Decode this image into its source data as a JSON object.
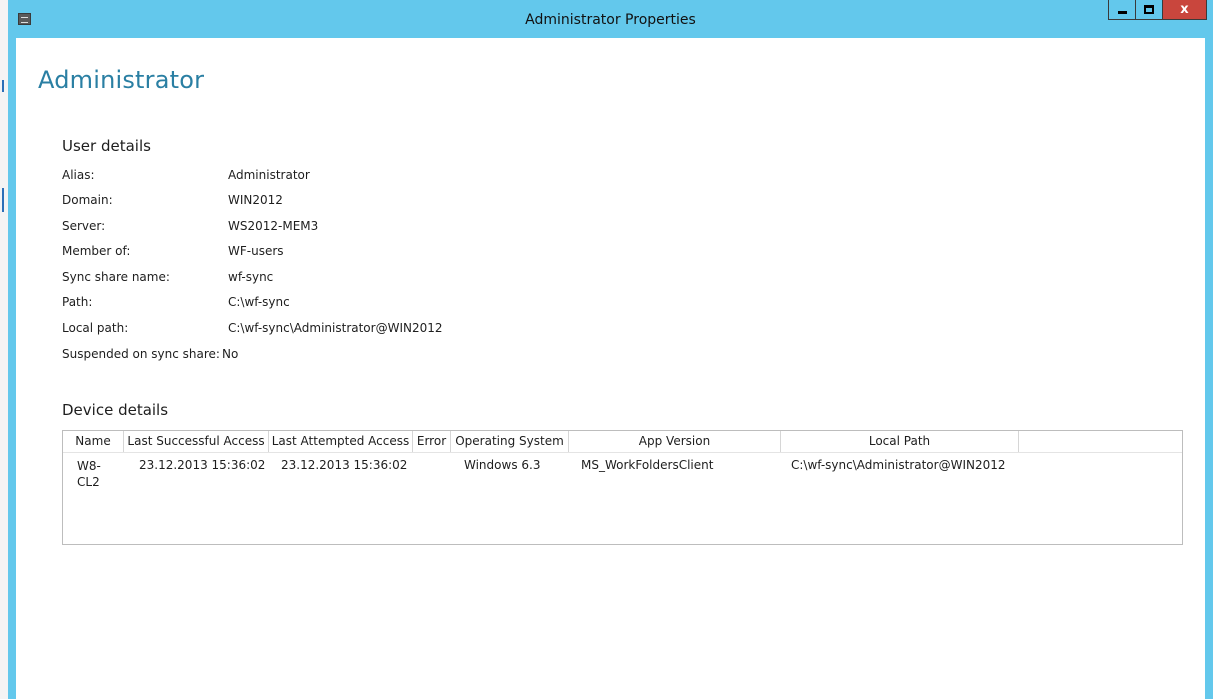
{
  "window": {
    "title": "Administrator Properties",
    "controls": {
      "minimize": "minimize",
      "maximize": "maximize",
      "close": "x"
    }
  },
  "page": {
    "heading": "Administrator"
  },
  "user_details": {
    "heading": "User details",
    "rows": [
      {
        "label": "Alias:",
        "value": "Administrator"
      },
      {
        "label": "Domain:",
        "value": "WIN2012"
      },
      {
        "label": "Server:",
        "value": "WS2012-MEM3"
      },
      {
        "label": "Member of:",
        "value": "WF-users"
      },
      {
        "label": "Sync share name:",
        "value": "wf-sync"
      },
      {
        "label": "Path:",
        "value": "C:\\wf-sync"
      },
      {
        "label": "Local path:",
        "value": "C:\\wf-sync\\Administrator@WIN2012"
      },
      {
        "label": "Suspended on sync share:",
        "value": "No"
      }
    ]
  },
  "device_details": {
    "heading": "Device details",
    "columns": [
      "Name",
      "Last Successful Access",
      "Last Attempted Access",
      "Error",
      "Operating System",
      "App Version",
      "Local Path",
      ""
    ],
    "rows": [
      {
        "name": "W8-CL2",
        "last_successful": "23.12.2013 15:36:02",
        "last_attempted": "23.12.2013 15:36:02",
        "error": "",
        "os": "Windows 6.3",
        "app_version": "MS_WorkFoldersClient",
        "local_path": "C:\\wf-sync\\Administrator@WIN2012"
      }
    ]
  },
  "colors": {
    "titlebar": "#63c8ec",
    "close_button": "#c9463d",
    "heading": "#2a7fa3"
  }
}
